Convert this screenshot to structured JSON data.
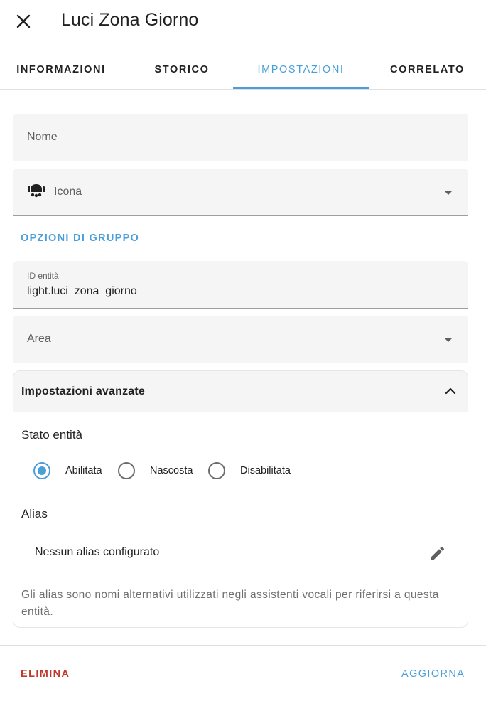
{
  "header": {
    "title": "Luci Zona Giorno",
    "close_icon": "close-icon"
  },
  "tabs": [
    {
      "label": "INFORMAZIONI",
      "active": false
    },
    {
      "label": "STORICO",
      "active": false
    },
    {
      "label": "IMPOSTAZIONI",
      "active": true
    },
    {
      "label": "CORRELATO",
      "active": false
    }
  ],
  "form": {
    "name_label": "Nome",
    "icon_label": "Icona",
    "icon_name": "ceiling-light-multiple-icon",
    "group_options_label": "OPZIONI DI GRUPPO",
    "entity_id_label": "ID entità",
    "entity_id_value": "light.luci_zona_giorno",
    "area_label": "Area"
  },
  "advanced": {
    "title": "Impostazioni avanzate",
    "expanded": true,
    "entity_state_label": "Stato entità",
    "states": [
      {
        "label": "Abilitata",
        "checked": true
      },
      {
        "label": "Nascosta",
        "checked": false
      },
      {
        "label": "Disabilitata",
        "checked": false
      }
    ],
    "alias_label": "Alias",
    "alias_empty_text": "Nessun alias configurato",
    "alias_help": "Gli alias sono nomi alternativi utilizzati negli assistenti vocali per riferirsi a questa entità."
  },
  "footer": {
    "delete_label": "ELIMINA",
    "update_label": "AGGIORNA"
  },
  "colors": {
    "accent": "#4a9fd8",
    "danger": "#c0392b",
    "field_bg": "#f5f5f5"
  }
}
